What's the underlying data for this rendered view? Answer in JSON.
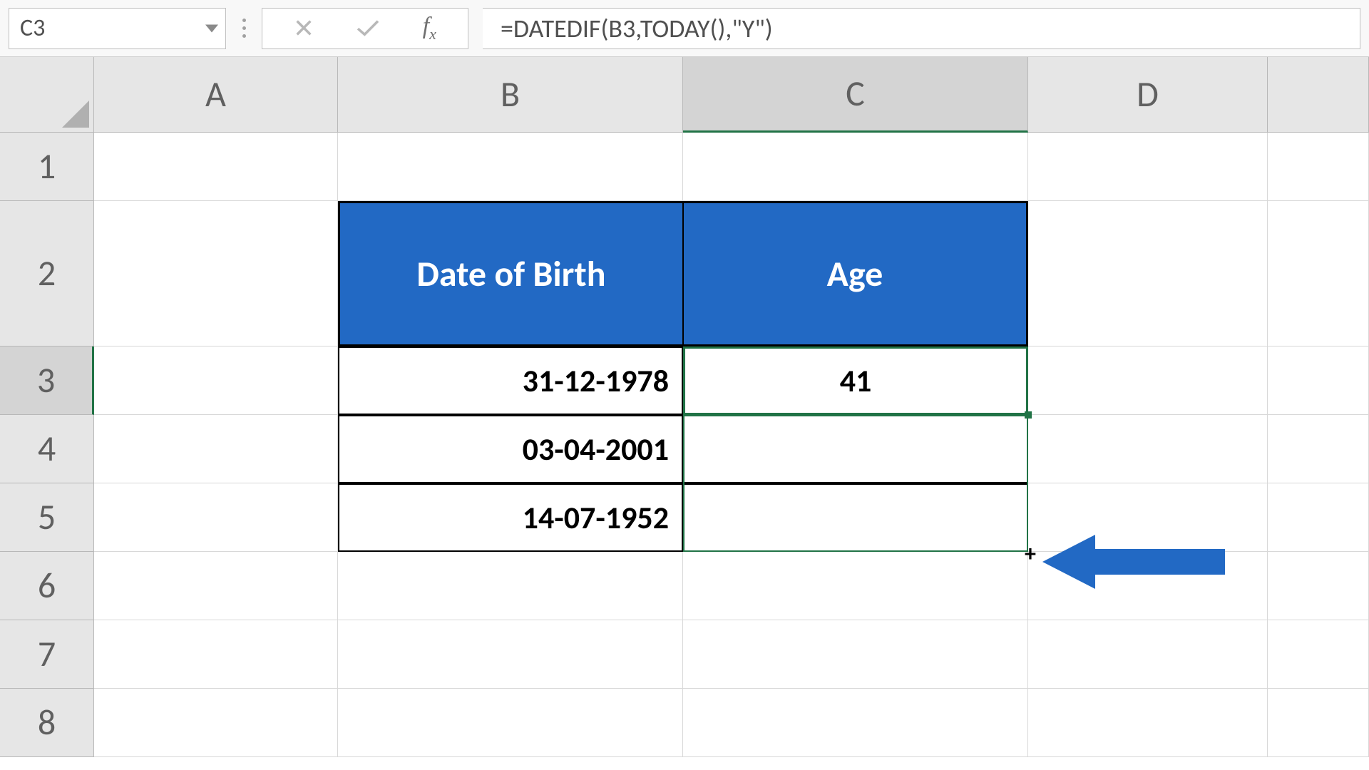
{
  "nameBox": {
    "value": "C3"
  },
  "formulaBar": {
    "value": "=DATEDIF(B3,TODAY(),\"Y\")"
  },
  "columns": [
    "A",
    "B",
    "C",
    "D"
  ],
  "rows": [
    "1",
    "2",
    "3",
    "4",
    "5",
    "6",
    "7",
    "8"
  ],
  "table": {
    "headers": {
      "b2": "Date of Birth",
      "c2": "Age"
    },
    "data": {
      "b3": "31-12-1978",
      "b4": "03-04-2001",
      "b5": "14-07-1952",
      "c3": "41",
      "c4": "",
      "c5": ""
    }
  },
  "selectedCell": "C3",
  "selectedColumn": "C",
  "selectedRow": "3"
}
